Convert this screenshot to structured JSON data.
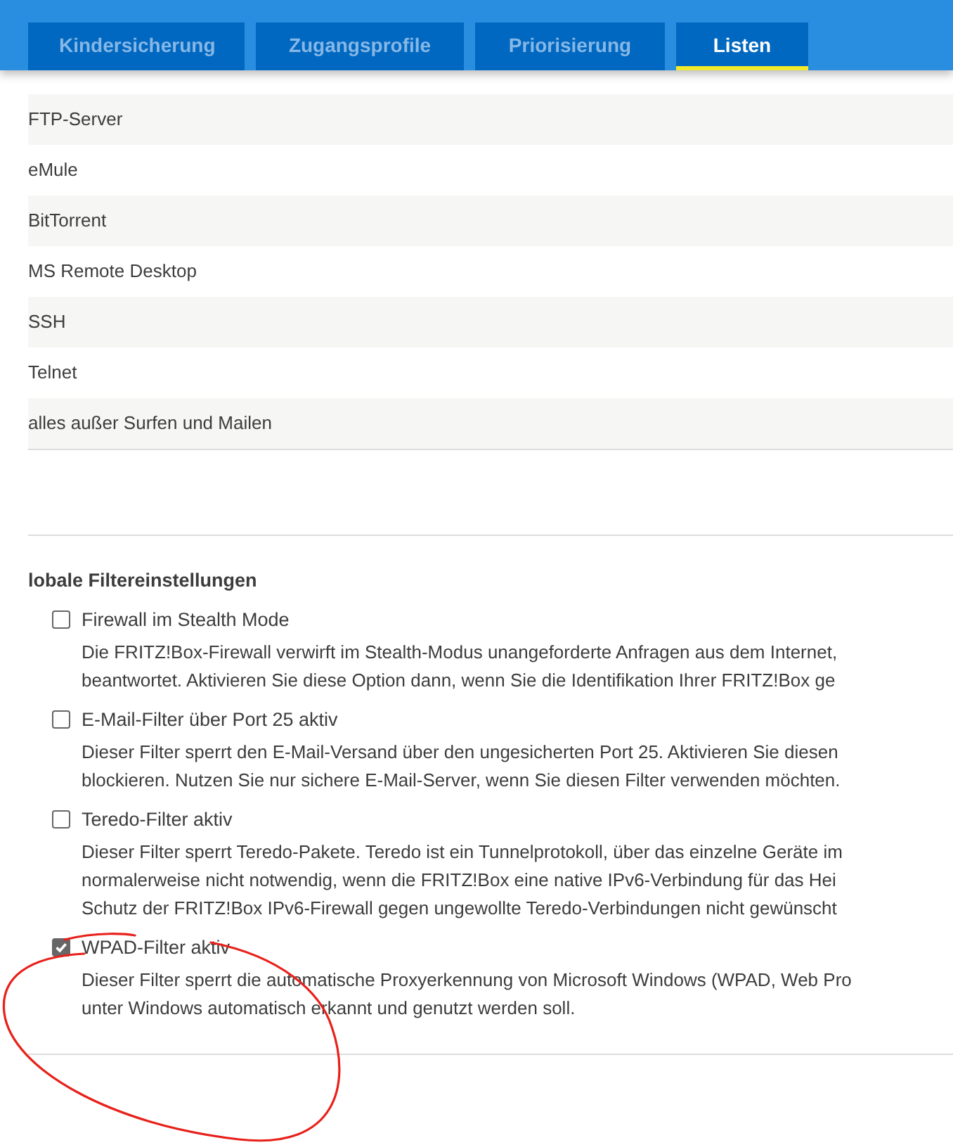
{
  "tabs": [
    {
      "label": "Kindersicherung",
      "selected": false
    },
    {
      "label": "Zugangsprofile",
      "selected": false
    },
    {
      "label": "Priorisierung",
      "selected": false
    },
    {
      "label": "Listen",
      "selected": true
    }
  ],
  "list": [
    "FTP-Server",
    "eMule",
    "BitTorrent",
    "MS Remote Desktop",
    "SSH",
    "Telnet",
    "alles außer Surfen und Mailen"
  ],
  "global_filters": {
    "heading": "lobale Filtereinstellungen",
    "options": [
      {
        "label": "Firewall im Stealth Mode",
        "checked": false,
        "description": [
          "Die FRITZ!Box-Firewall verwirft im Stealth-Modus unangeforderte Anfragen aus dem Internet,",
          "beantwortet. Aktivieren Sie diese Option dann, wenn Sie die Identifikation Ihrer FRITZ!Box ge"
        ]
      },
      {
        "label": "E-Mail-Filter über Port 25 aktiv",
        "checked": false,
        "description": [
          "Dieser Filter sperrt den E-Mail-Versand über den ungesicherten Port 25. Aktivieren Sie diesen",
          "blockieren. Nutzen Sie nur sichere E-Mail-Server, wenn Sie diesen Filter verwenden möchten."
        ]
      },
      {
        "label": "Teredo-Filter aktiv",
        "checked": false,
        "description": [
          "Dieser Filter sperrt Teredo-Pakete. Teredo ist ein Tunnelprotokoll, über das einzelne Geräte im",
          "normalerweise nicht notwendig, wenn die FRITZ!Box eine native IPv6-Verbindung für das Hei",
          "Schutz der FRITZ!Box IPv6-Firewall gegen ungewollte Teredo-Verbindungen nicht gewünscht"
        ]
      },
      {
        "label": "WPAD-Filter aktiv",
        "checked": true,
        "description": [
          "Dieser Filter sperrt die automatische Proxyerkennung von Microsoft Windows (WPAD, Web Pro",
          "unter Windows automatisch erkannt und genutzt werden soll."
        ]
      }
    ]
  }
}
